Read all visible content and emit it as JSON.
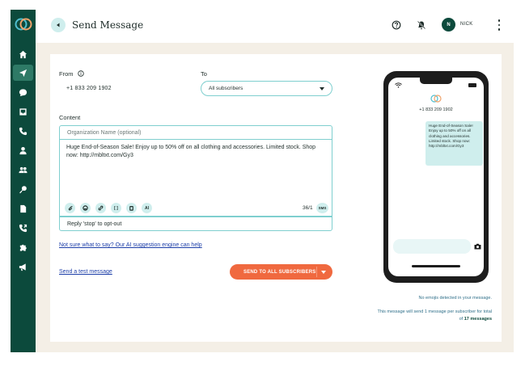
{
  "header": {
    "title": "Send Message",
    "avatar_initial": "N",
    "user_name": "NICK"
  },
  "form": {
    "from_label": "From",
    "from_value": "+1 833 209 1902",
    "to_label": "To",
    "to_value": "All subscribers",
    "content_label": "Content",
    "org_placeholder": "Organization Name (optional)",
    "message": "Huge End-of-Season Sale! Enjoy up to 50% off on all clothing and accessories. Limited stock. Shop now: http://mbltxt.com/Gy3",
    "tools": [
      {
        "label": ""
      },
      {
        "label": ""
      },
      {
        "label": ""
      },
      {
        "label": "[ ]"
      },
      {
        "label": ""
      },
      {
        "label": "AI"
      }
    ],
    "char_counter": "36/1",
    "sms_badge": "SMS",
    "optout_text": "Reply 'stop' to opt-out",
    "ai_link": "Not sure what to say? Our AI suggestion engine can help",
    "test_link": "Send a test message",
    "send_button": "SEND TO ALL SUBSCRIBERS"
  },
  "preview": {
    "phone_number": "+1 833 209 1902",
    "bubble_text": "Huge End-of-Season Sale! Enjoy up to 50% off on all clothing and accessories. Limited stock. Shop now: http://mbltxt.com/Gy3",
    "emoji_note": "No emojis detected in your message.",
    "count_note_prefix": "This message will send 1 message per subscriber for total of ",
    "count_note_bold": "17 messages"
  },
  "colors": {
    "sidebar": "#0c4a3c",
    "accent": "#f0693f",
    "teal_light": "#cfeeed",
    "border": "#7fcfcf",
    "link": "#1c3ea8"
  },
  "icons": {
    "sidebar": [
      "home-icon",
      "send-icon",
      "chat-icon",
      "inbox-icon",
      "phone-icon",
      "user-icon",
      "users-icon",
      "key-icon",
      "document-icon",
      "call-forward-icon",
      "puzzle-icon",
      "megaphone-icon"
    ]
  }
}
